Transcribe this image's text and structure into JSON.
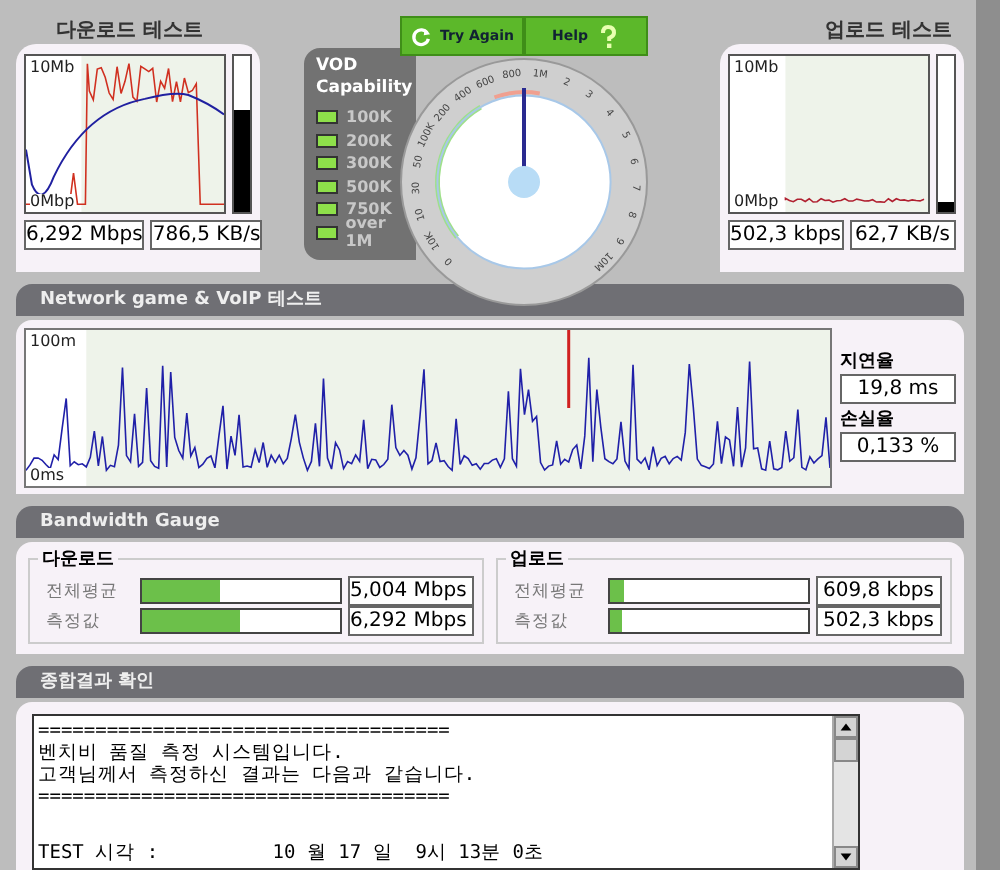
{
  "download_test": {
    "title": "다운로드 테스트",
    "y_max_label": "10Mb",
    "y_min_label": "0Mbp",
    "meter": {
      "level": 0.65
    },
    "readings": [
      "6,292 Mbps",
      "786,5 KB/s"
    ]
  },
  "vod": {
    "title": "VOD Capability",
    "items": [
      {
        "label": "100K",
        "on": true
      },
      {
        "label": "200K",
        "on": true
      },
      {
        "label": "300K",
        "on": true
      },
      {
        "label": "500K",
        "on": true
      },
      {
        "label": "750K",
        "on": true
      },
      {
        "label": "over 1M",
        "on": true
      }
    ]
  },
  "buttons": [
    {
      "label": "Try Again",
      "kind": "refresh"
    },
    {
      "label": "Help",
      "kind": "help"
    }
  ],
  "dial": {
    "labels": [
      "0",
      "10K",
      "10",
      "30",
      "50",
      "100K",
      "200",
      "400",
      "600",
      "800",
      "1M",
      "2",
      "3",
      "4",
      "5",
      "6",
      "7",
      "8",
      "9",
      "10M"
    ],
    "needle": {
      "level": 0.5
    }
  },
  "upload_test": {
    "title": "업로드 테스트",
    "y_max_label": "10Mb",
    "y_min_label": "0Mbp",
    "meter": {
      "level": 0.06
    },
    "readings": [
      "502,3 kbps",
      "62,7 KB/s"
    ]
  },
  "ping": {
    "title": "Network game & VoIP 테스트",
    "y_max_label": "100m",
    "y_min_label": "0ms",
    "stats": [
      {
        "label": "지연율",
        "value": "19,8 ms"
      },
      {
        "label": "손실율",
        "value": "0,133 %"
      }
    ]
  },
  "gauge": {
    "title": "Bandwidth Gauge",
    "groups": [
      {
        "title": "다운로드",
        "rows": [
          {
            "label": "전체평균",
            "level": 0.39,
            "value": "5,004 Mbps"
          },
          {
            "label": "측정값",
            "level": 0.49,
            "value": "6,292 Mbps"
          }
        ]
      },
      {
        "title": "업로드",
        "rows": [
          {
            "label": "전체평균",
            "level": 0.07,
            "value": "609,8 kbps"
          },
          {
            "label": "측정값",
            "level": 0.06,
            "value": "502,3 kbps"
          }
        ]
      }
    ]
  },
  "summary": {
    "title": "종합결과 확인",
    "lines": [
      "====================================",
      "벤치비 품질 측정 시스템입니다.",
      "고객님께서 측정하신 결과는 다음과 같습니다.",
      "====================================",
      "TEST 시각 :          10 월 17 일  9시 13분 0초"
    ]
  }
}
